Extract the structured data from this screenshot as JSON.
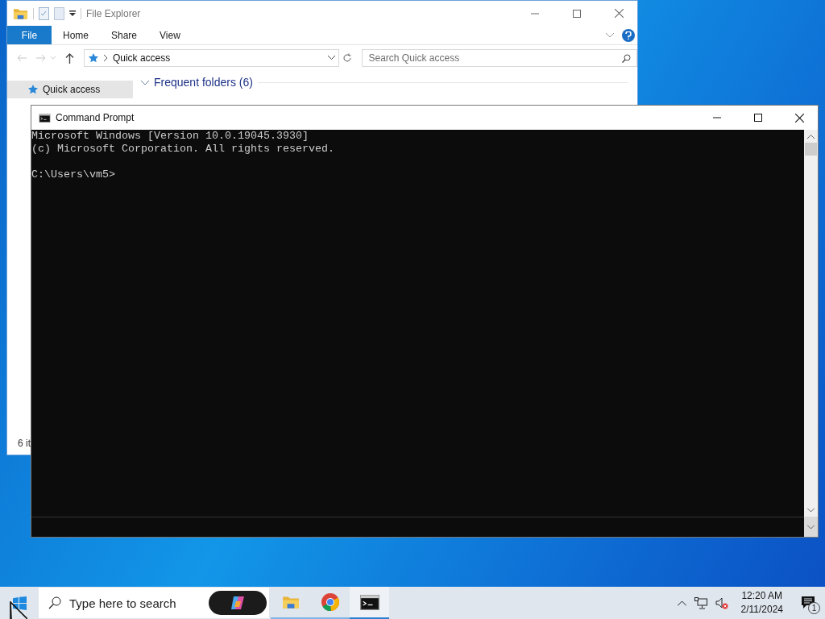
{
  "explorer": {
    "title": "File Explorer",
    "file_tab": "File",
    "ribbon_tabs": [
      "Home",
      "Share",
      "View"
    ],
    "address": "Quick access",
    "search": {
      "placeholder": "Search Quick access"
    },
    "nav_items": [
      {
        "label": "Quick access",
        "selected": true
      }
    ],
    "section_header": "Frequent folders (6)",
    "status": "6 it"
  },
  "console": {
    "title": "Command Prompt",
    "output_lines": [
      "Microsoft Windows [Version 10.0.19045.3930]",
      "(c) Microsoft Corporation. All rights reserved."
    ],
    "prompt": "C:\\Users\\vm5>"
  },
  "taskbar": {
    "search": {
      "placeholder": "Type here to search"
    },
    "apps": [
      {
        "kind": "explorer",
        "selected": false
      },
      {
        "kind": "chrome",
        "selected": false
      },
      {
        "kind": "cmd",
        "selected": true
      }
    ],
    "clock": {
      "time": "12:20 AM",
      "date": "2/11/2024"
    },
    "notification_count": "1"
  }
}
